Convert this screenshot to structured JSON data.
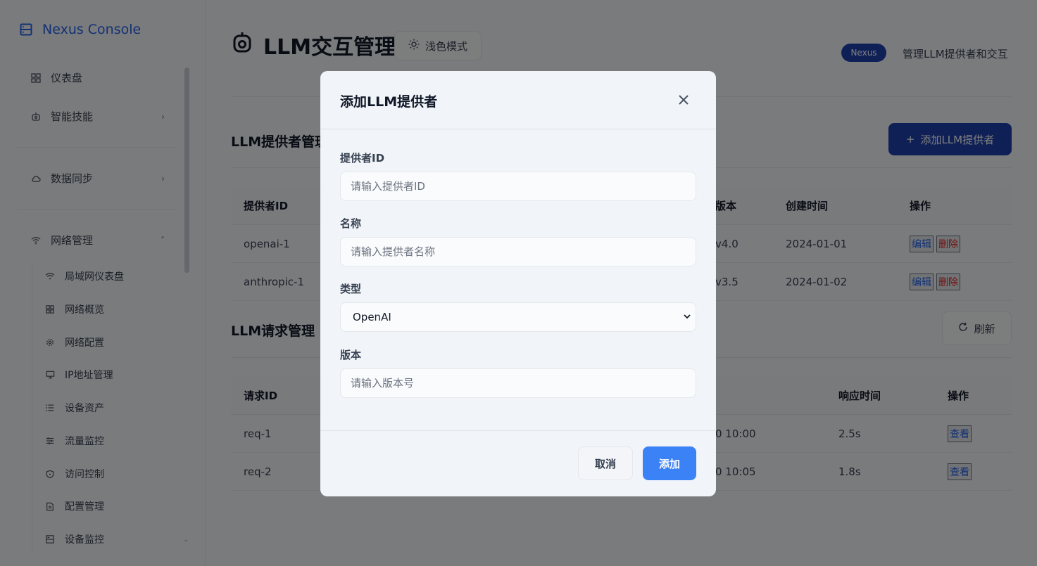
{
  "brand": {
    "name": "Nexus Console",
    "icon": "server-icon",
    "color": "#2563eb"
  },
  "sidebar": {
    "items": [
      {
        "label": "仪表盘",
        "icon": "grid-icon"
      },
      {
        "label": "智能技能",
        "icon": "robot-icon",
        "chevron": "›"
      },
      {
        "label": "数据同步",
        "icon": "cloud-icon",
        "chevron": "›"
      },
      {
        "label": "网络管理",
        "icon": "wifi-icon",
        "chevron": "˄"
      }
    ],
    "sub_items": [
      {
        "label": "局域网仪表盘",
        "icon": "wifi-icon"
      },
      {
        "label": "网络概览",
        "icon": "grid-icon"
      },
      {
        "label": "网络配置",
        "icon": "gear-icon"
      },
      {
        "label": "IP地址管理",
        "icon": "monitor-icon"
      },
      {
        "label": "设备资产",
        "icon": "list-icon"
      },
      {
        "label": "流量监控",
        "icon": "sliders-icon"
      },
      {
        "label": "访问控制",
        "icon": "shield-icon"
      },
      {
        "label": "配置管理",
        "icon": "file-icon"
      },
      {
        "label": "设备监控",
        "icon": "device-icon"
      }
    ]
  },
  "header": {
    "title": "LLM交互管理",
    "theme_label": "浅色模式",
    "badge": "Nexus",
    "subtitle": "管理LLM提供者和交互"
  },
  "providers": {
    "title": "LLM提供者管理",
    "add_label": "添加LLM提供者",
    "columns": [
      "提供者ID",
      "版本",
      "创建时间",
      "操作"
    ],
    "rows": [
      {
        "id": "openai-1",
        "version": "v4.0",
        "created": "2024-01-01",
        "edit": "编辑",
        "delete": "删除"
      },
      {
        "id": "anthropic-1",
        "version": "v3.5",
        "created": "2024-01-02",
        "edit": "编辑",
        "delete": "删除"
      }
    ]
  },
  "requests": {
    "title": "LLM请求管理",
    "refresh_label": "刷新",
    "columns": [
      "请求ID",
      "响应时间",
      "操作"
    ],
    "rows": [
      {
        "id": "req-1",
        "time": "0 10:00",
        "response": "2.5s",
        "view": "查看"
      },
      {
        "id": "req-2",
        "time": "0 10:05",
        "response": "1.8s",
        "view": "查看"
      }
    ]
  },
  "modal": {
    "title": "添加LLM提供者",
    "fields": {
      "provider_id": {
        "label": "提供者ID",
        "placeholder": "请输入提供者ID"
      },
      "name": {
        "label": "名称",
        "placeholder": "请输入提供者名称"
      },
      "type": {
        "label": "类型",
        "value": "OpenAI"
      },
      "version": {
        "label": "版本",
        "placeholder": "请输入版本号"
      }
    },
    "cancel_label": "取消",
    "submit_label": "添加",
    "submit_color": "#3b82f6"
  }
}
